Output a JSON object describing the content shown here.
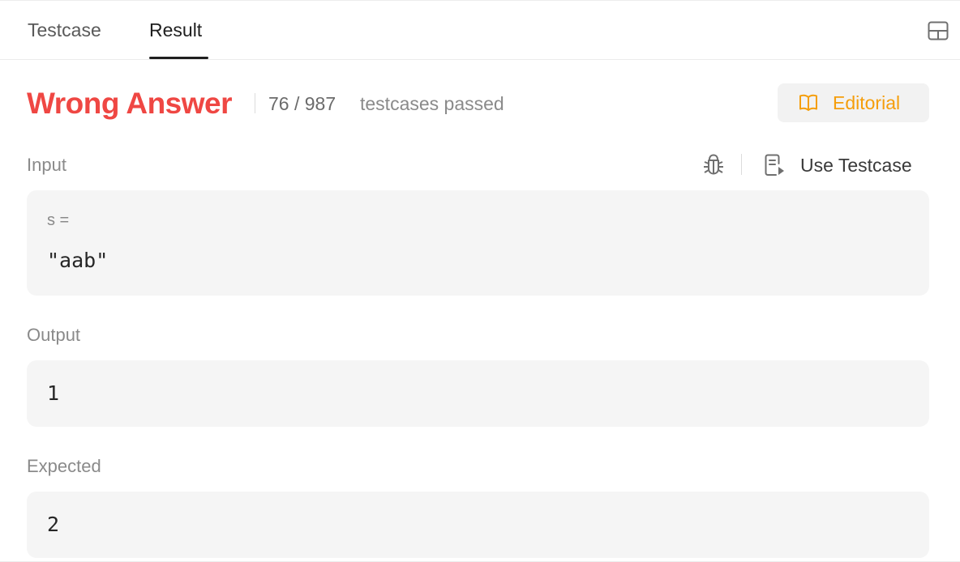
{
  "tabs": {
    "testcase_label": "Testcase",
    "result_label": "Result",
    "active": "Result"
  },
  "result": {
    "status": "Wrong Answer",
    "passed_count": "76 / 987",
    "passed_label": "testcases passed",
    "editorial_label": "Editorial"
  },
  "input": {
    "label": "Input",
    "use_testcase_label": "Use Testcase",
    "param_name": "s =",
    "param_value": "\"aab\""
  },
  "output": {
    "label": "Output",
    "value": "1"
  },
  "expected": {
    "label": "Expected",
    "value": "2"
  },
  "colors": {
    "error": "#ef4743",
    "accent": "#f59e0b",
    "box_bg": "#f5f5f5"
  },
  "icons": {
    "layout": "layout-panel-icon",
    "editorial": "book-open-icon",
    "debug": "bug-icon",
    "use_testcase": "file-play-icon"
  }
}
